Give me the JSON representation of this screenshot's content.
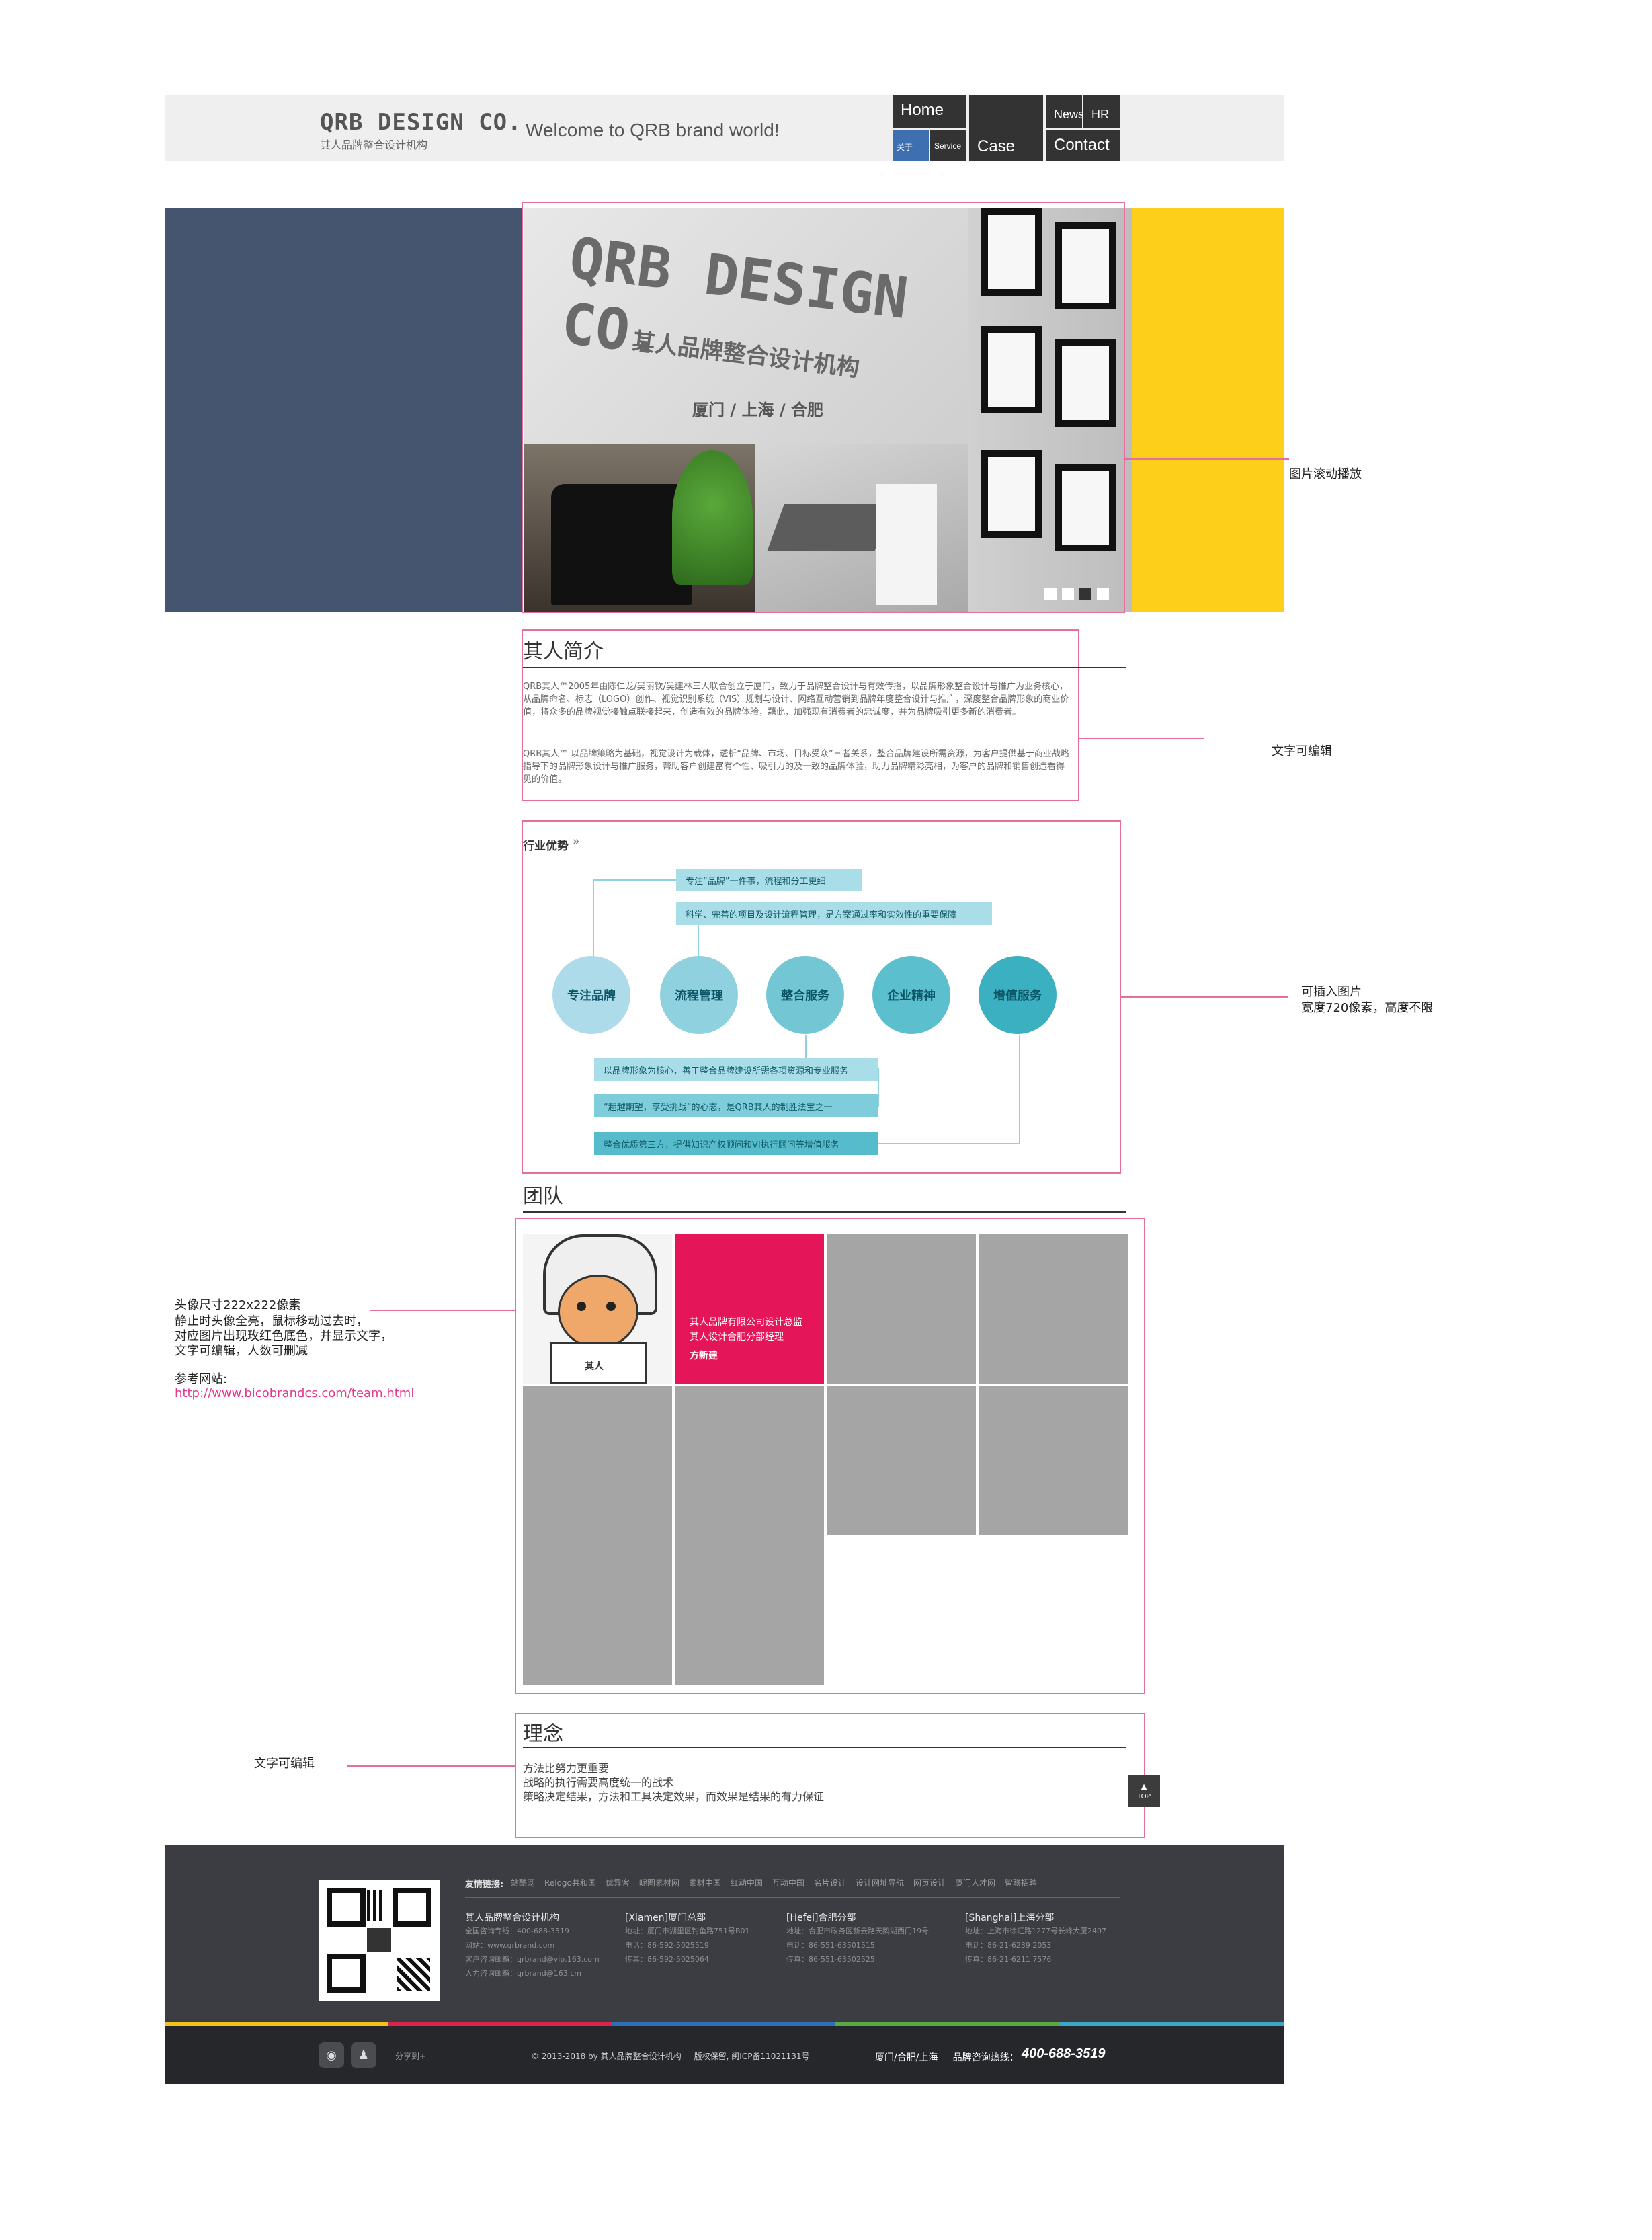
{
  "header": {
    "logo_main": "QRB DESIGN CO.",
    "logo_sub": "其人品牌整合设计机构",
    "welcome": "Welcome to QRB brand world!",
    "nav": {
      "home": "Home",
      "about": "关于",
      "service": "Service",
      "case": "Case",
      "news": "News",
      "hr": "HR",
      "contact": "Contact"
    }
  },
  "hero": {
    "sign_title": "QRB DESIGN CO.",
    "sign_sub": "其人品牌整合设计机构",
    "sign_city": "厦门 / 上海 / 合肥",
    "slider_dots": 4,
    "active_dot": 3
  },
  "notes": {
    "slider": "图片滚动播放",
    "intro_editable": "文字可编辑",
    "adv_line1": "可插入图片",
    "adv_line2": "宽度720像素，高度不限",
    "team_line1": "头像尺寸222x222像素",
    "team_line2": "静止时头像全亮，鼠标移动过去时，",
    "team_line3": "对应图片出现玫红色底色，并显示文字，",
    "team_line4": "文字可编辑，人数可删减",
    "team_ref_label": "参考网站:",
    "team_ref_url": "http://www.bicobrandcs.com/team.html",
    "idea_editable": "文字可编辑"
  },
  "intro": {
    "title": "其人简介",
    "p1": "QRB其人™2005年由陈仁龙/吴丽钦/吴建林三人联合创立于厦门，致力于品牌整合设计与有效传播，以品牌形象整合设计与推广为业务核心，从品牌命名、标志（LOGO）创作、视觉识别系统（VIS）规划与设计、网络互动营销到品牌年度整合设计与推广，深度整合品牌形象的商业价值，将众多的品牌视觉接触点联接起来，创造有效的品牌体验，藉此，加强现有消费者的忠诚度，并为品牌吸引更多新的消费者。",
    "p2": "QRB其人™ 以品牌策略为基础，视觉设计为载体，透析“品牌、市场、目标受众”三者关系，整合品牌建设所需资源，为客户提供基于商业战略指导下的品牌形象设计与推广服务，帮助客户创建富有个性、吸引力的及一致的品牌体验，助力品牌精彩亮相，为客户的品牌和销售创造看得见的价值。"
  },
  "advantage": {
    "label": "行业优势",
    "arrow": "»",
    "top_tags": [
      "专注“品牌”一件事，流程和分工更细",
      "科学、完善的项目及设计流程管理，是方案通过率和实效性的重要保障"
    ],
    "circles": [
      "专注品牌",
      "流程管理",
      "整合服务",
      "企业精神",
      "增值服务"
    ],
    "bottom_tags": [
      "以品牌形象为核心，善于整合品牌建设所需各项资源和专业服务",
      "“超越期望，享受挑战”的心态，是QRB其人的制胜法宝之一",
      "整合优质第三方，提供知识产权顾问和VI执行顾问等增值服务"
    ],
    "colors": {
      "c1": "#aedbea",
      "c2": "#90d1df",
      "c3": "#73c7d5",
      "c4": "#5bbfcd",
      "c5": "#3bb0c0",
      "tag_light": "#a9dde8",
      "tag_mid": "#7fccda",
      "tag_dark": "#56bccb"
    }
  },
  "team": {
    "title": "团队",
    "hover_line1": "其人品牌有限公司设计总监",
    "hover_line2": "其人设计合肥分部经理",
    "hover_name": "方新建",
    "hover_color": "#e5155a",
    "avatar_label": "其人"
  },
  "idea": {
    "title": "理念",
    "lines": [
      "方法比努力更重要",
      "战略的执行需要高度统一的战术",
      "策略决定结果，方法和工具决定效果，而效果是结果的有力保证"
    ]
  },
  "top_button": {
    "label": "TOP"
  },
  "footer": {
    "links_label": "友情链接:",
    "links": [
      "站酷网",
      "Relogo共和国",
      "优异客",
      "昵图素材网",
      "素材中国",
      "红动中国",
      "互动中国",
      "名片设计",
      "设计网址导航",
      "网页设计",
      "厦门人才网",
      "智联招聘"
    ],
    "hq": {
      "title": "其人品牌整合设计机构",
      "phone": "全国咨询专线：400-688-3519",
      "site": "网站：www.qrbrand.com",
      "email1": "客户咨询邮箱：qrbrand@vip.163.com",
      "email2": "人力咨询邮箱：qrbrand@163.cm"
    },
    "xiamen": {
      "title": "[Xiamen]厦门总部",
      "addr": "地址：厦门市湖里区钓鱼路751号B01",
      "tel": "电话：86-592-5025519",
      "fax": "传真：86-592-5025064"
    },
    "hefei": {
      "title": "[Hefei]合肥分部",
      "addr": "地址：合肥市政务区新云路天鹅湖西门19号",
      "tel": "电话：86-551-63501515",
      "fax": "传真：86-551-63502525"
    },
    "shanghai": {
      "title": "[Shanghai]上海分部",
      "addr": "地址：上海市徐汇路1277号长峰大厦2407",
      "tel": "电话：86-21-6239 2053",
      "fax": "传真：86-21-6211 7576"
    },
    "stripe_colors": [
      "#f0c21a",
      "#d8234d",
      "#2e6fb9",
      "#5aa842",
      "#3aa7c7"
    ],
    "share": "分享到+",
    "copyright": "© 2013-2018 by 其人品牌整合设计机构     版权保留, 闽ICP备11021131号",
    "cities": "厦门/合肥/上海     品牌咨询热线：",
    "hotline": "400-688-3519"
  }
}
